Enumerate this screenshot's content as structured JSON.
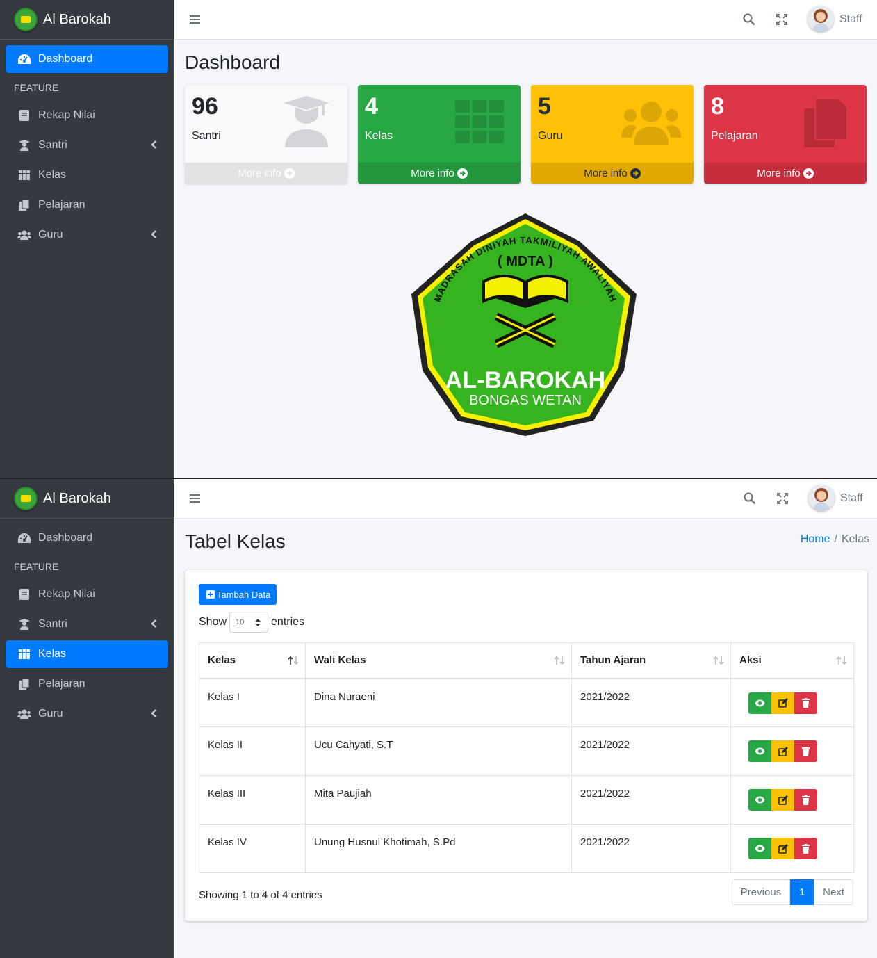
{
  "app": {
    "brand": "Al Barokah",
    "user": "Staff"
  },
  "sidebar": {
    "items": [
      {
        "label": "Dashboard",
        "icon": "tachometer-icon"
      },
      {
        "label": "FEATURE"
      },
      {
        "label": "Rekap Nilai",
        "icon": "book-icon"
      },
      {
        "label": "Santri",
        "icon": "graduate-icon"
      },
      {
        "label": "Kelas",
        "icon": "grid-icon"
      },
      {
        "label": "Pelajaran",
        "icon": "copy-icon"
      },
      {
        "label": "Guru",
        "icon": "users-icon"
      }
    ]
  },
  "dashboard": {
    "title": "Dashboard",
    "boxes": [
      {
        "value": "96",
        "label": "Santri",
        "footer": "More info",
        "color": "#f8f9fa"
      },
      {
        "value": "4",
        "label": "Kelas",
        "footer": "More info",
        "color": "#28a745"
      },
      {
        "value": "5",
        "label": "Guru",
        "footer": "More info",
        "color": "#ffc107"
      },
      {
        "value": "8",
        "label": "Pelajaran",
        "footer": "More info",
        "color": "#dc3545"
      }
    ],
    "logo": {
      "arc": "MADRASAH DINIYAH TAKMILIYAH AWALIYAH",
      "abbr": "( MDTA )",
      "name": "AL-BAROKAH",
      "place": "BONGAS WETAN"
    }
  },
  "kelas_page": {
    "title": "Tabel Kelas",
    "breadcrumb": {
      "home": "Home",
      "current": "Kelas"
    },
    "add_button": "Tambah Data",
    "show_label": "Show",
    "entries_value": "10",
    "entries_label": "entries",
    "columns": [
      "Kelas",
      "Wali Kelas",
      "Tahun Ajaran",
      "Aksi"
    ],
    "rows": [
      {
        "kelas": "Kelas I",
        "wali": "Dina Nuraeni",
        "tahun": "2021/2022"
      },
      {
        "kelas": "Kelas II",
        "wali": "Ucu Cahyati, S.T",
        "tahun": "2021/2022"
      },
      {
        "kelas": "Kelas III",
        "wali": "Mita Paujiah",
        "tahun": "2021/2022"
      },
      {
        "kelas": "Kelas IV",
        "wali": "Unung Husnul Khotimah, S.Pd",
        "tahun": "2021/2022"
      }
    ],
    "info": "Showing 1 to 4 of 4 entries",
    "pagination": {
      "previous": "Previous",
      "current": "1",
      "next": "Next"
    }
  }
}
